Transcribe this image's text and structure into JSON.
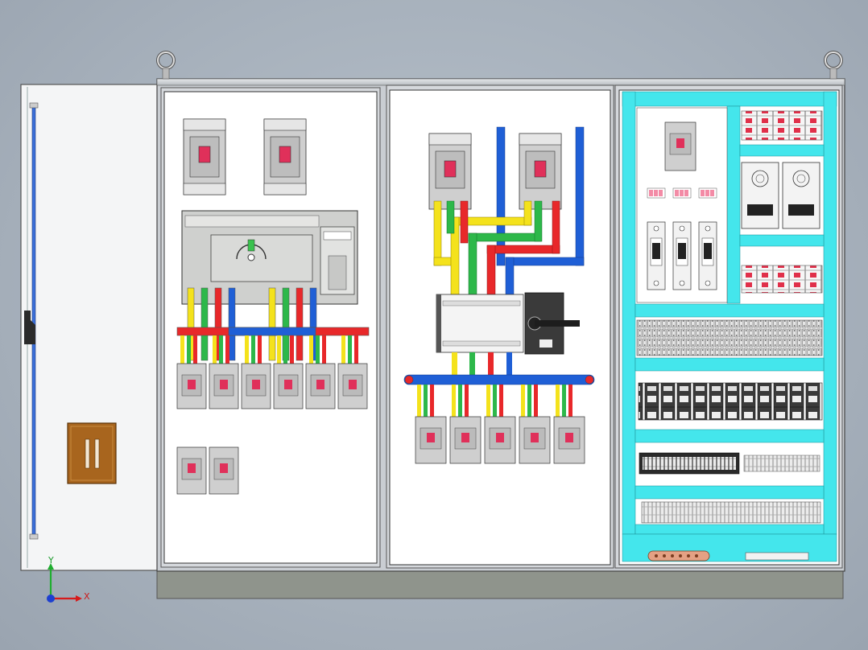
{
  "view_triad": {
    "x_label": "X",
    "y_label": "Y"
  },
  "colors": {
    "cyan_rail": "#44e6ec",
    "bus_red": "#e8282a",
    "bus_blue": "#1f5fd6",
    "bus_yellow": "#f4e21c",
    "bus_green": "#2db84a",
    "cabinet_frame": "#c9cdd2",
    "panel_white": "#ffffff",
    "plinth": "#8f948c",
    "door_handle": "#a8651e"
  },
  "icons": [
    "lifting-eye-icon",
    "view-axis-triad-icon",
    "door-handle-icon",
    "rotary-switch-icon"
  ]
}
